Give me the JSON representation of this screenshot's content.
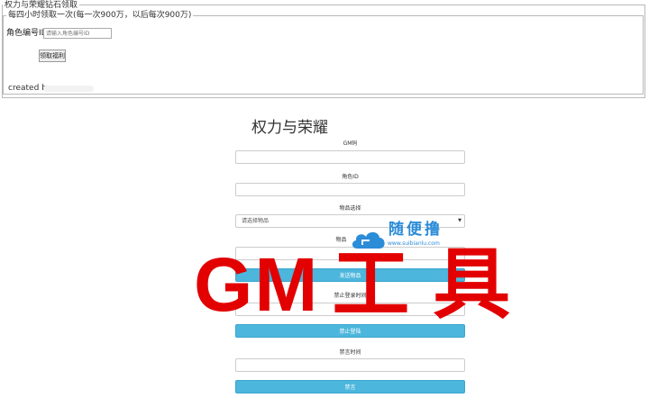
{
  "top_panel": {
    "legend": "权力与荣耀钻石领取",
    "inner_legend": "每四小时领取一次(每一次900万，以后每次900万)",
    "role_label": "角色编号ID：",
    "role_placeholder": "请输入角色编号ID",
    "claim_button": "领取福利",
    "created_by": "created by"
  },
  "form": {
    "title": "权力与荣耀",
    "gm_code_label": "GM码",
    "role_id_label": "角色ID",
    "item_select_label": "物品选择",
    "item_select_value": "请选择物品",
    "item_count_label": "物品",
    "send_button": "发送物品",
    "ban_login_time_label": "禁止登录时间",
    "ban_login_button": "禁止登陆",
    "mute_time_label": "禁言时间",
    "mute_button": "禁言"
  },
  "watermark": {
    "name": "随便撸",
    "url": "www.suibianlu.com",
    "color": "#2b8cd8"
  },
  "overlay": {
    "text_latin": "GM",
    "text_cn": "工具",
    "color": "#e20000"
  },
  "colors": {
    "button_blue": "#4cb6dc",
    "border": "#cccccc"
  }
}
